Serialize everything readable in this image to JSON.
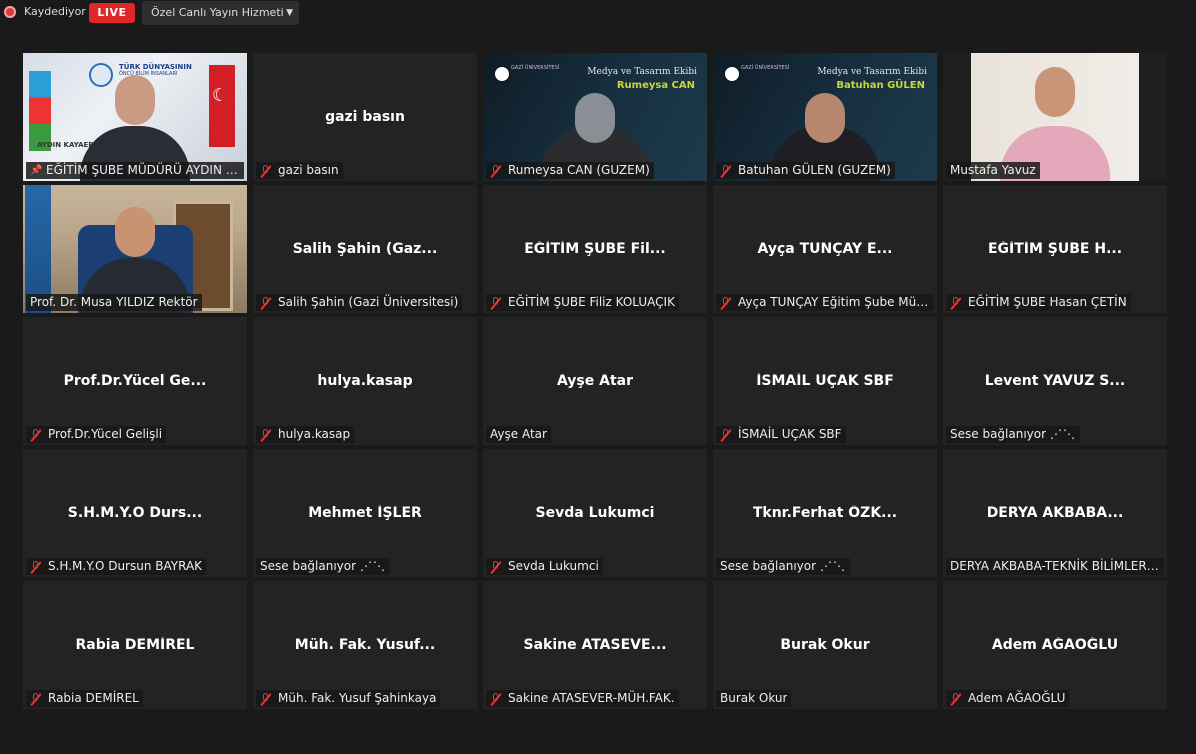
{
  "topbar": {
    "recording_label": "Kaydediyor",
    "live_label": "LIVE",
    "stream_label": "Özel Canlı Yayın Hizmeti"
  },
  "tiles": [
    {
      "name": "EĞİTİM ŞUBE MÜDÜRÜ AYDIN K...",
      "display": "",
      "muted": false,
      "pinned": true,
      "video": "aydin",
      "active": true,
      "overlay": {
        "banner": "TÜRK DÜNYASININ",
        "banner2": "ÖNCÜ BİLİM İNSANLARI",
        "logo_text": "AYDIN KAYAER"
      }
    },
    {
      "name": "gazi basın",
      "display": "gazi basın",
      "muted": true
    },
    {
      "name": "Rumeysa CAN (GUZEM)",
      "display": "",
      "muted": true,
      "video": "guzem",
      "overlay": {
        "team": "Medya ve Tasarım Ekibi",
        "person": "Rumeysa CAN",
        "small": "GAZİ ÜNİVERSİTESİ"
      }
    },
    {
      "name": "Batuhan GÜLEN (GUZEM)",
      "display": "",
      "muted": true,
      "video": "guzem",
      "overlay": {
        "team": "Medya ve Tasarım Ekibi",
        "person": "Batuhan GÜLEN",
        "small": "GAZİ ÜNİVERSİTESİ"
      }
    },
    {
      "name": "Mustafa Yavuz",
      "display": "",
      "muted": false,
      "video": "mustafa"
    },
    {
      "name": "Prof. Dr. Musa YILDIZ Rektör",
      "display": "",
      "muted": false,
      "video": "musa"
    },
    {
      "name": "Salih Şahin (Gazi Üniversitesi)",
      "display": "Salih Şahin (Gaz...",
      "muted": true
    },
    {
      "name": "EĞİTİM ŞUBE Filiz KOLUAÇIK",
      "display": "EĞİTİM ŞUBE Fil...",
      "muted": true
    },
    {
      "name": "Ayça TUNÇAY Eğitim Şube Müdü...",
      "display": "Ayça TUNÇAY E...",
      "muted": true
    },
    {
      "name": "EĞİTİM ŞUBE Hasan ÇETİN",
      "display": "EĞİTİM ŞUBE H...",
      "muted": true
    },
    {
      "name": "Prof.Dr.Yücel Gelişli",
      "display": "Prof.Dr.Yücel Ge...",
      "muted": true
    },
    {
      "name": "hulya.kasap",
      "display": "hulya.kasap",
      "muted": true
    },
    {
      "name": "Ayşe Atar",
      "display": "Ayşe Atar",
      "muted": false
    },
    {
      "name": "İSMAİL UÇAK SBF",
      "display": "İSMAİL UÇAK SBF",
      "muted": true
    },
    {
      "name": "Sese bağlanıyor",
      "display": "Levent YAVUZ S...",
      "muted": false,
      "connecting": true
    },
    {
      "name": "S.H.M.Y.O  Dursun BAYRAK",
      "display": "S.H.M.Y.O   Durs...",
      "muted": true
    },
    {
      "name": "Sese bağlanıyor",
      "display": "Mehmet İŞLER",
      "muted": false,
      "connecting": true
    },
    {
      "name": "Sevda Lukumci",
      "display": "Sevda Lukumci",
      "muted": true
    },
    {
      "name": "Sese bağlanıyor",
      "display": "Tknr.Ferhat  ÖZK...",
      "muted": false,
      "connecting": true
    },
    {
      "name": "DERYA AKBABA-TEKNİK BİLİMLER M...",
      "display": "DERYA AKBABA...",
      "muted": false
    },
    {
      "name": "Rabia DEMİREL",
      "display": "Rabia DEMİREL",
      "muted": true
    },
    {
      "name": "Müh. Fak. Yusuf Şahinkaya",
      "display": "Müh.  Fak.  Yusuf...",
      "muted": true
    },
    {
      "name": "Sakine ATASEVER-MÜH.FAK.",
      "display": "Sakine  ATASEVE...",
      "muted": true
    },
    {
      "name": "Burak Okur",
      "display": "Burak Okur",
      "muted": false
    },
    {
      "name": "Adem AĞAOĞLU",
      "display": "Adem AĞAOĞLU",
      "muted": true
    }
  ],
  "connecting_dots": "⋰⋱"
}
